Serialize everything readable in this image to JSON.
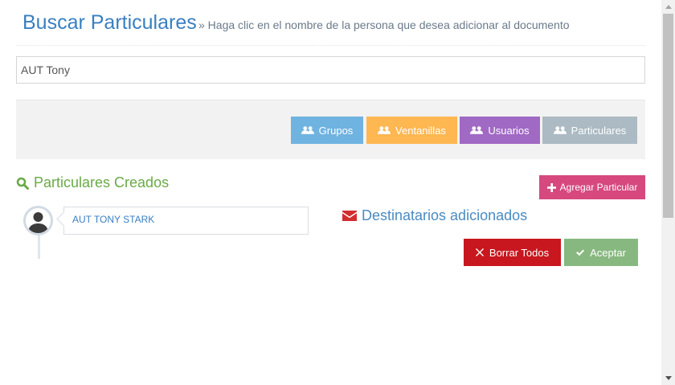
{
  "header": {
    "title": "Buscar Particulares",
    "subtitle": "» Haga clic en el nombre de la persona que desea adicionar al documento"
  },
  "search": {
    "value": "AUT Tony"
  },
  "filters": [
    {
      "label": "Grupos",
      "color": "#6fb3e0",
      "icon": "users-icon"
    },
    {
      "label": "Ventanillas",
      "color": "#ffb752",
      "icon": "users-icon"
    },
    {
      "label": "Usuarios",
      "color": "#a069c3",
      "icon": "users-icon"
    },
    {
      "label": "Particulares",
      "color": "#abbac3",
      "icon": "users-icon"
    }
  ],
  "created_section": {
    "title": "Particulares Creados",
    "icon": "search-icon",
    "add_button": "Agregar Particular",
    "people": [
      {
        "name": "AUT TONY STARK"
      }
    ]
  },
  "recipients": {
    "title": "Destinatarios adicionados",
    "icon": "envelope-icon",
    "clear_button": "Borrar Todos",
    "accept_button": "Aceptar"
  },
  "colors": {
    "title_blue": "#3a7fc1",
    "section_green": "#69aa46",
    "add_pink": "#d6487e",
    "danger_red": "#c8171e",
    "success_green": "#87b87f"
  }
}
